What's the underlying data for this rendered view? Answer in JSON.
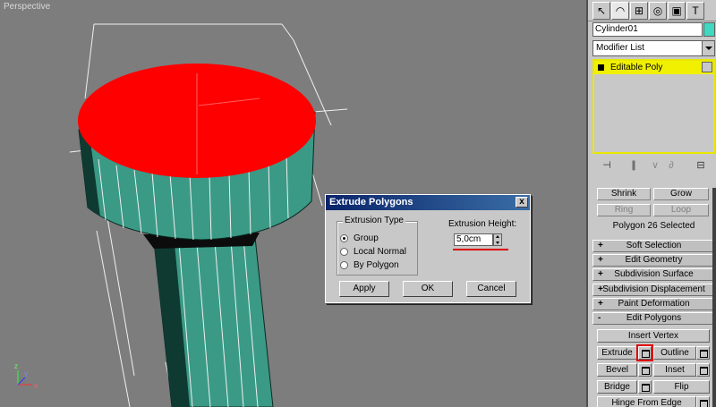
{
  "viewport": {
    "label": "Perspective",
    "axis_x": "x",
    "axis_y": "y",
    "axis_z": "z"
  },
  "dialog": {
    "title": "Extrude Polygons",
    "close_label": "x",
    "group_label": "Extrusion Type",
    "options": [
      "Group",
      "Local Normal",
      "By Polygon"
    ],
    "selected_option": "Group",
    "height_label": "Extrusion Height:",
    "height_value": "5,0cm",
    "buttons": {
      "apply": "Apply",
      "ok": "OK",
      "cancel": "Cancel"
    }
  },
  "panel": {
    "object_name": "Cylinder01",
    "object_color": "#40d8c0",
    "modifier_list": "Modifier List",
    "stack_item": "Editable Poly",
    "selection": {
      "shrink": "Shrink",
      "grow": "Grow",
      "ring": "Ring",
      "loop": "Loop",
      "status": "Polygon 26 Selected"
    },
    "rollouts": [
      {
        "sign": "+",
        "label": "Soft Selection"
      },
      {
        "sign": "+",
        "label": "Edit Geometry"
      },
      {
        "sign": "+",
        "label": "Subdivision Surface"
      },
      {
        "sign": "+",
        "label": "Subdivision Displacement"
      },
      {
        "sign": "+",
        "label": "Paint Deformation"
      },
      {
        "sign": "-",
        "label": "Edit Polygons"
      }
    ],
    "edit_polygons": {
      "insert_vertex": "Insert Vertex",
      "extrude": "Extrude",
      "outline": "Outline",
      "bevel": "Bevel",
      "inset": "Inset",
      "bridge": "Bridge",
      "flip": "Flip",
      "hinge": "Hinge From Edge"
    }
  }
}
